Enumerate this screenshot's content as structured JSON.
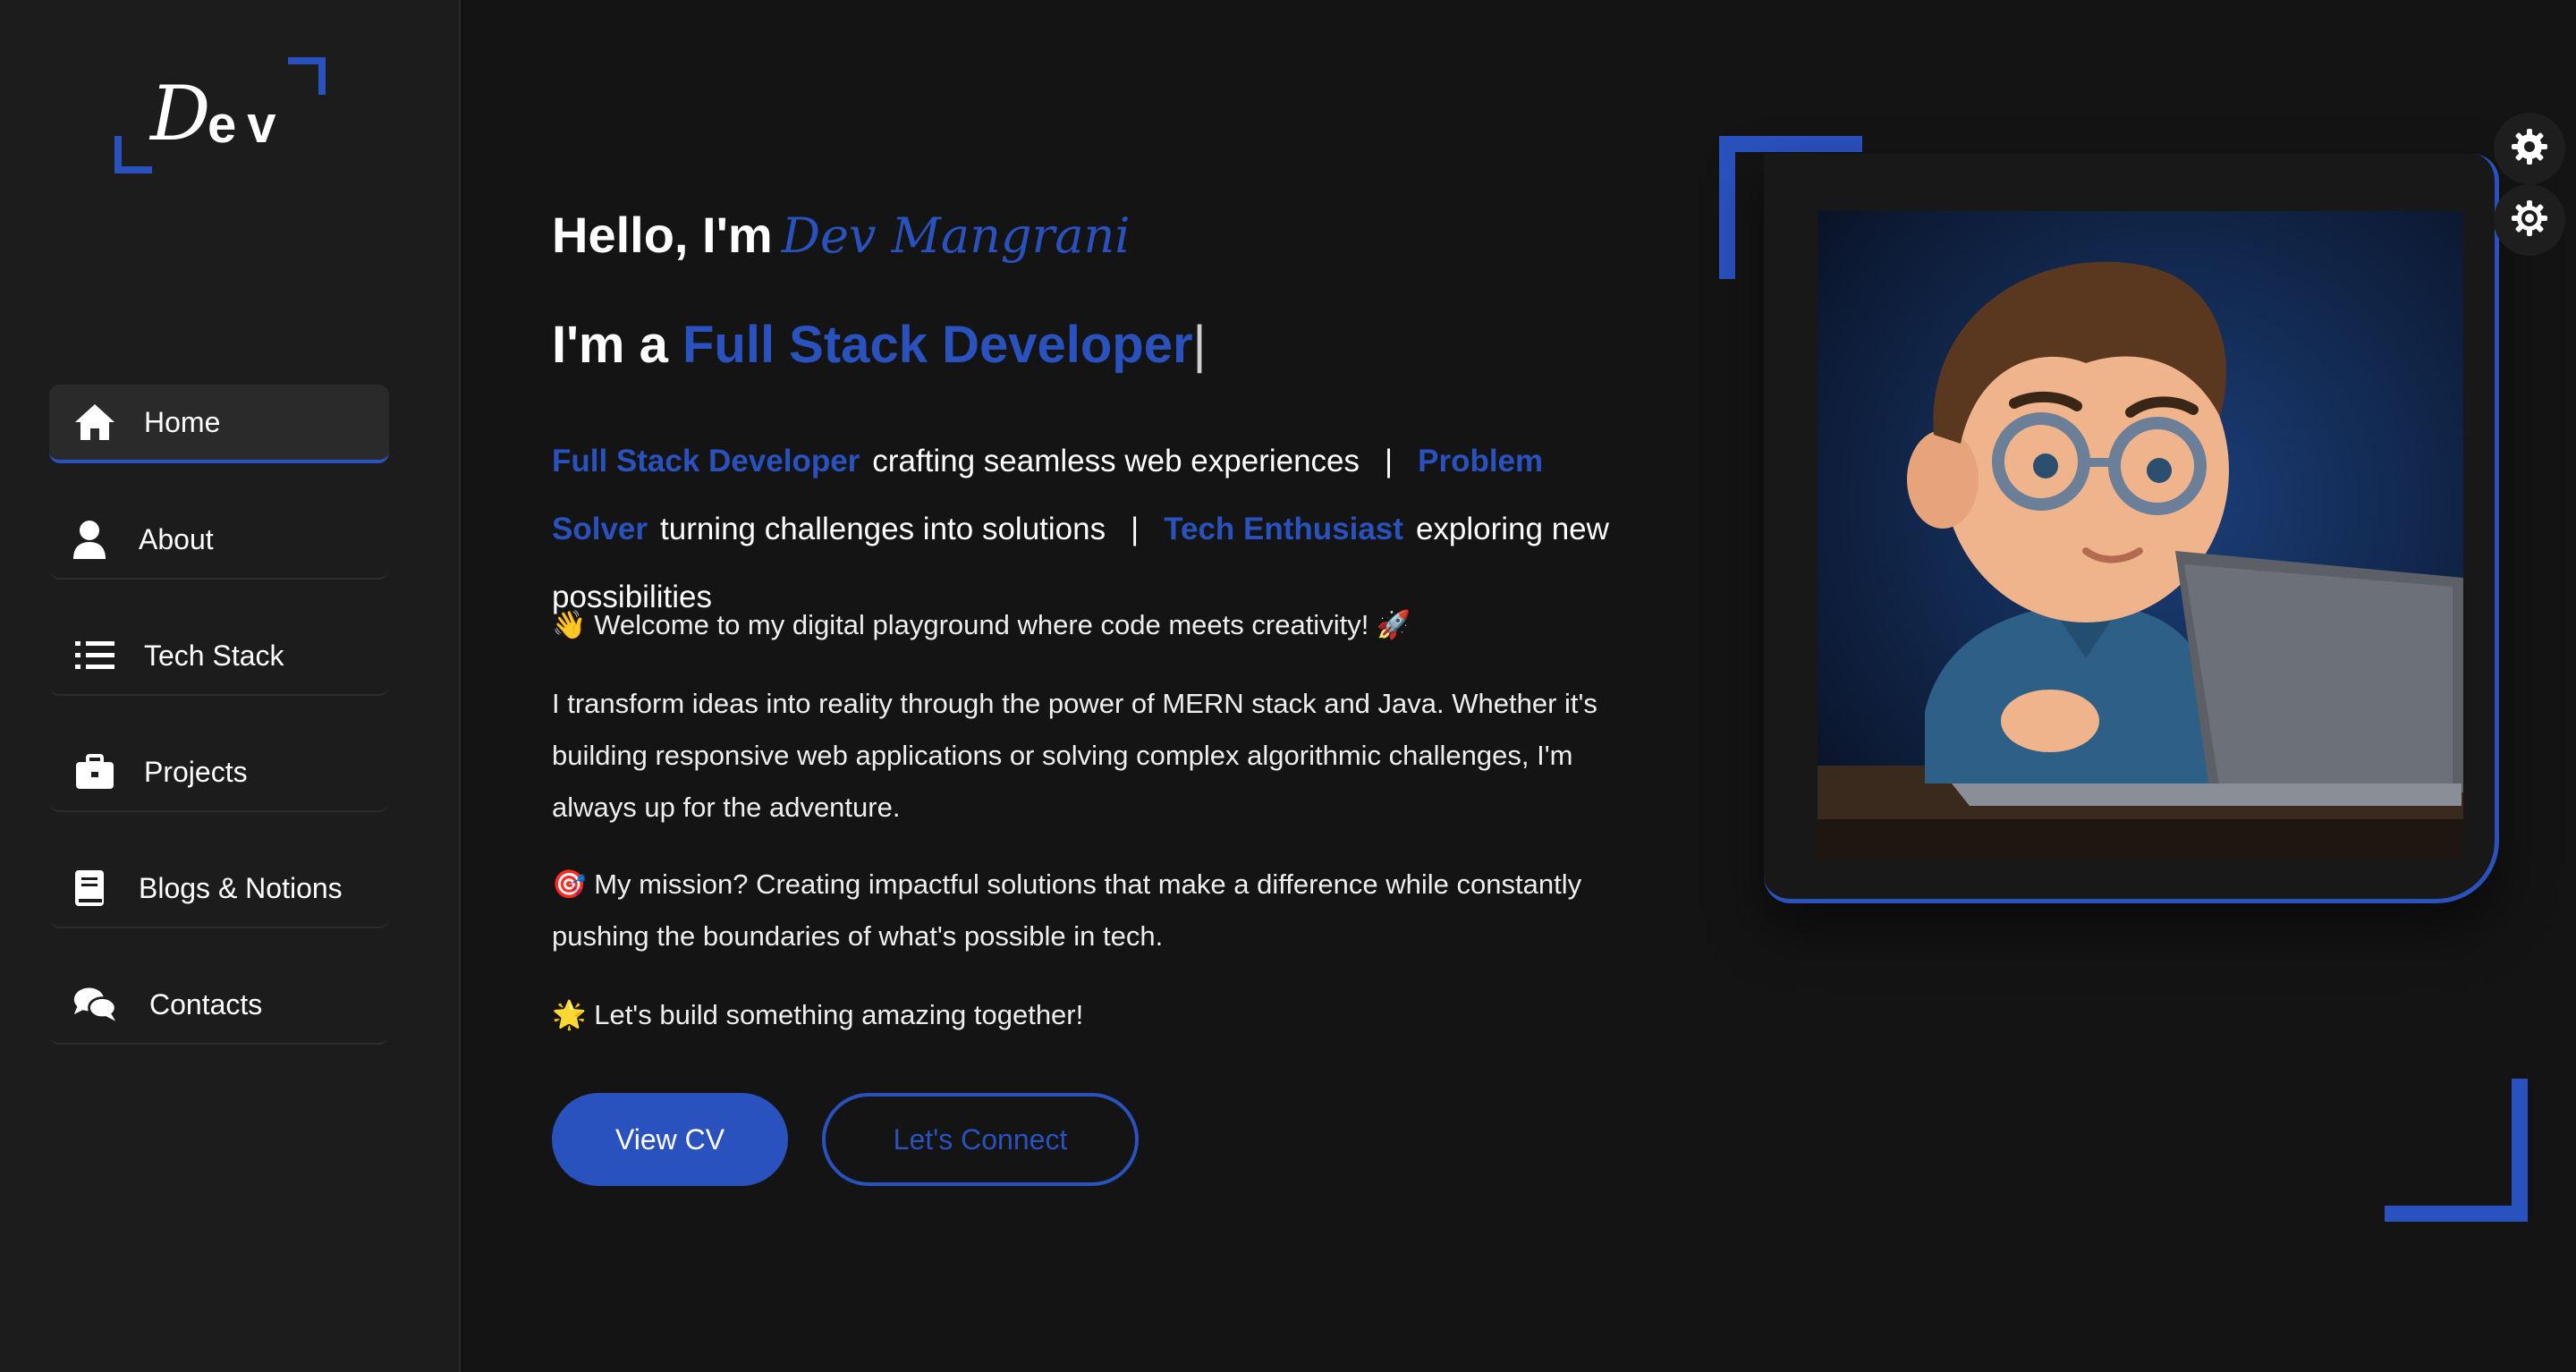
{
  "logo": {
    "letter": "D",
    "rest": "ev"
  },
  "nav": [
    {
      "label": "Home",
      "icon": "home-icon",
      "active": true
    },
    {
      "label": "About",
      "icon": "user-icon"
    },
    {
      "label": "Tech Stack",
      "icon": "list-icon"
    },
    {
      "label": "Projects",
      "icon": "briefcase-icon"
    },
    {
      "label": "Blogs & Notions",
      "icon": "book-icon"
    },
    {
      "label": "Contacts",
      "icon": "chat-icon"
    }
  ],
  "hero": {
    "greeting": "Hello, I'm",
    "name": "Dev Mangrani",
    "role_prefix": "I'm a",
    "role": "Full Stack Developer",
    "caret": "|",
    "tagline": [
      {
        "accent": "Full Stack Developer",
        "text": "crafting seamless web experiences"
      },
      {
        "accent": "Problem Solver",
        "text": "turning challenges into solutions"
      },
      {
        "accent": "Tech Enthusiast",
        "text": "exploring new possibilities"
      }
    ],
    "separator": "|",
    "paragraphs": [
      "👋 Welcome to my digital playground where code meets creativity! 🚀",
      "I transform ideas into reality through the power of MERN stack and Java. Whether it's building responsive web applications or solving complex algorithmic challenges, I'm always up for the adventure.",
      "🎯 My mission? Creating impactful solutions that make a difference while constantly pushing the boundaries of what's possible in tech.",
      "🌟 Let's build something amazing together!"
    ],
    "primary_button": "View CV",
    "secondary_button": "Let's Connect"
  },
  "colors": {
    "accent": "#2a52be",
    "background": "#141414",
    "sidebar": "#1c1c1c"
  },
  "floating": [
    {
      "icon": "gear-icon"
    },
    {
      "icon": "theme-gear-icon"
    }
  ]
}
